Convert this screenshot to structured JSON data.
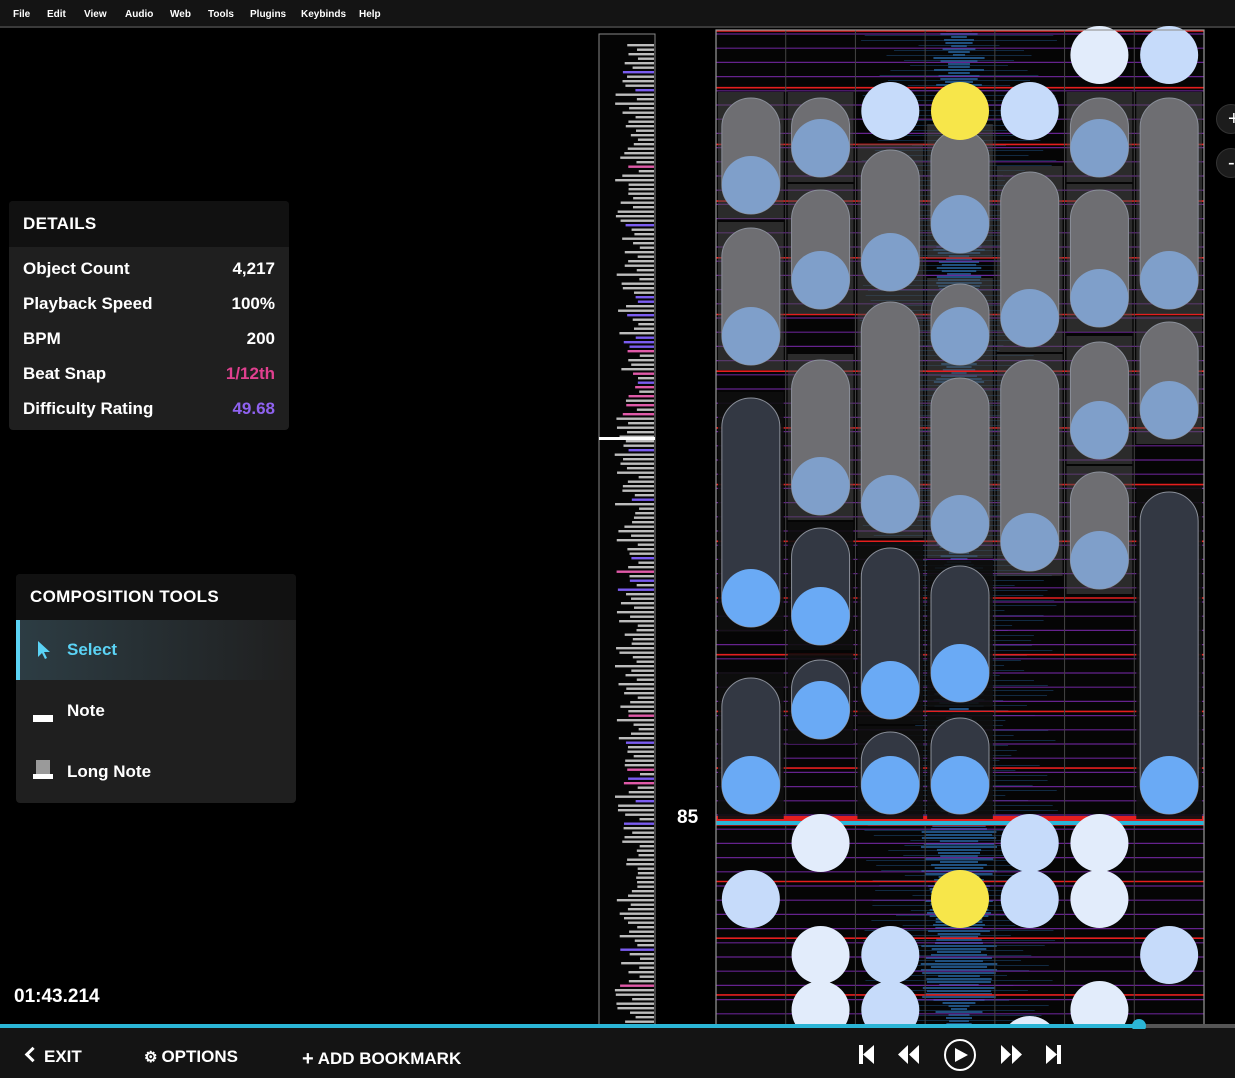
{
  "menu": [
    "File",
    "Edit",
    "View",
    "Audio",
    "Web",
    "Tools",
    "Plugins",
    "Keybinds",
    "Help"
  ],
  "details": {
    "title": "DETAILS",
    "rows": [
      {
        "label": "Object Count",
        "value": "4,217",
        "color": "#ffffff"
      },
      {
        "label": "Playback Speed",
        "value": "100%",
        "color": "#ffffff"
      },
      {
        "label": "BPM",
        "value": "200",
        "color": "#ffffff"
      },
      {
        "label": "Beat Snap",
        "value": "1/12th",
        "color": "#e0408f"
      },
      {
        "label": "Difficulty Rating",
        "value": "49.68",
        "color": "#8f62f0"
      }
    ]
  },
  "composition": {
    "title": "COMPOSITION TOOLS",
    "tools": [
      {
        "label": "Select",
        "icon": "cursor-icon",
        "selected": true
      },
      {
        "label": "Note",
        "icon": "note-icon",
        "selected": false
      },
      {
        "label": "Long Note",
        "icon": "long-note-icon",
        "selected": false
      }
    ]
  },
  "time": "01:43.214",
  "measure": "85",
  "zoom": {
    "in": "+",
    "out": "-"
  },
  "playback_progress": 0.922,
  "bottom": {
    "exit": "EXIT",
    "options": "OPTIONS",
    "bookmark": "ADD BOOKMARK"
  },
  "transport": [
    "skip-start-icon",
    "rewind-icon",
    "play-icon",
    "fast-forward-icon",
    "skip-end-icon"
  ],
  "colors": {
    "accent": "#2bb5d6",
    "note": "#6aaaf5",
    "note_highlight": "#f7e64a",
    "beat_line": "#e51e1e",
    "snap_line": "#8a2fb8"
  }
}
